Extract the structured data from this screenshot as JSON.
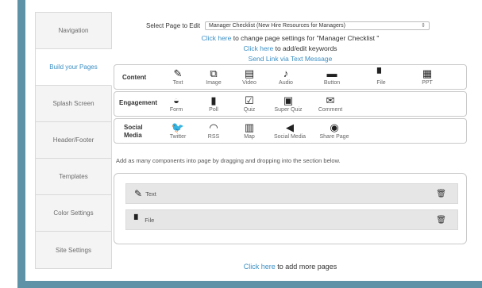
{
  "sidebar": {
    "tabs": [
      {
        "label": "Navigation"
      },
      {
        "label": "Build your Pages",
        "active": true
      },
      {
        "label": "Splash Screen"
      },
      {
        "label": "Header/Footer"
      },
      {
        "label": "Templates"
      },
      {
        "label": "Color Settings"
      },
      {
        "label": "Site Settings"
      }
    ]
  },
  "select_page": {
    "label": "Select Page to Edit",
    "value": "Manager Checklist (New Hire Resources for Managers)"
  },
  "links": {
    "settings_link": "Click here",
    "settings_rest": " to change page settings for \"Manager Checklist \"",
    "keywords_link": "Click here",
    "keywords_rest": " to add/edit keywords",
    "send_link": "Send Link via Text Message"
  },
  "rows": {
    "content": {
      "label": "Content",
      "items": [
        {
          "label": "Text",
          "icon": "edit-icon",
          "glyph": "✎"
        },
        {
          "label": "Image",
          "icon": "image-icon",
          "glyph": "⧉"
        },
        {
          "label": "Video",
          "icon": "video-icon",
          "glyph": "▤"
        },
        {
          "label": "Audio",
          "icon": "music-note-icon",
          "glyph": "♪"
        },
        {
          "label": "Button",
          "icon": "button-icon",
          "glyph": "▬"
        },
        {
          "label": "File",
          "icon": "file-icon",
          "glyph": "▘"
        },
        {
          "label": "PPT",
          "icon": "presentation-icon",
          "glyph": "▦"
        }
      ]
    },
    "engagement": {
      "label": "Engagement",
      "items": [
        {
          "label": "Form",
          "icon": "inbox-icon",
          "glyph": "◒"
        },
        {
          "label": "Poll",
          "icon": "bar-chart-icon",
          "glyph": "▮"
        },
        {
          "label": "Quiz",
          "icon": "checkbox-icon",
          "glyph": "☑"
        },
        {
          "label": "Super Quiz",
          "icon": "clipboard-icon",
          "glyph": "▣"
        },
        {
          "label": "Comment",
          "icon": "comment-icon",
          "glyph": "✉"
        }
      ]
    },
    "social": {
      "label_line1": "Social",
      "label_line2": "Media",
      "items": [
        {
          "label": "Twitter",
          "icon": "twitter-icon",
          "glyph": "🐦"
        },
        {
          "label": "RSS",
          "icon": "rss-icon",
          "glyph": "◠"
        },
        {
          "label": "Map",
          "icon": "map-icon",
          "glyph": "▥"
        },
        {
          "label": "Social Media",
          "icon": "megaphone-icon",
          "glyph": "◀"
        },
        {
          "label": "Share Page",
          "icon": "share-icon",
          "glyph": "◉"
        }
      ]
    }
  },
  "instructions": "Add as many components into page by dragging and dropping into the section below.",
  "dropzone": {
    "items": [
      {
        "label": "Text",
        "icon": "edit-icon",
        "glyph": "✎"
      },
      {
        "label": "File",
        "icon": "file-icon",
        "glyph": "▘"
      }
    ]
  },
  "footer": {
    "link": "Click here",
    "rest": " to add more pages"
  },
  "colors": {
    "frame": "#5e93a7",
    "link": "#3b8fc4",
    "twitter": "#3aa1e0"
  }
}
